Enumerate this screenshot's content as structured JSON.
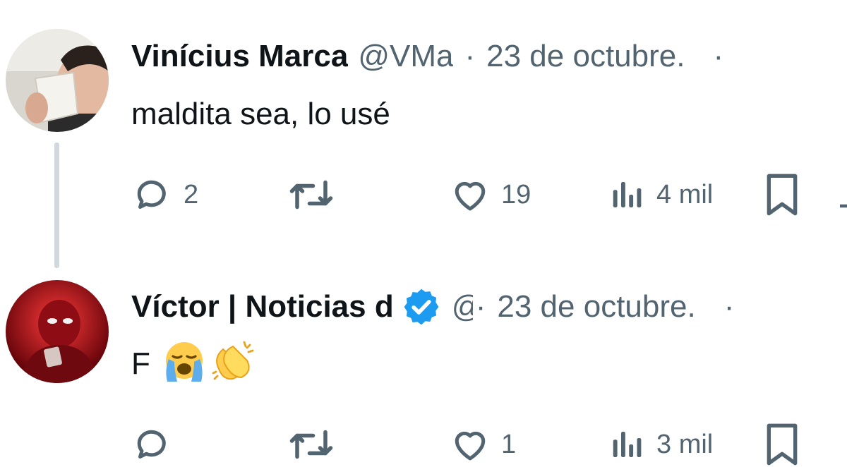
{
  "tweets": [
    {
      "author_name": "Vinícius Marca",
      "handle": "@VMa",
      "separator": "·",
      "date": "23 de octubre.",
      "more": "·",
      "text": "maldita sea, lo usé",
      "replies": "2",
      "retweets": "",
      "likes": "19",
      "views": "4 mil"
    },
    {
      "author_name": "Víctor | Noticias d",
      "handle": "@",
      "separator": "·",
      "date": "23 de octubre.",
      "more": "·",
      "text": "F",
      "emojis": [
        "loudly-crying-face",
        "clapping-hands"
      ],
      "replies": "",
      "retweets": "",
      "likes": "1",
      "views": "3 mil"
    }
  ],
  "colors": {
    "text_primary": "#0f1419",
    "text_secondary": "#536471",
    "verified_badge": "#1d9bf0",
    "thread_line": "#cfd9de"
  }
}
